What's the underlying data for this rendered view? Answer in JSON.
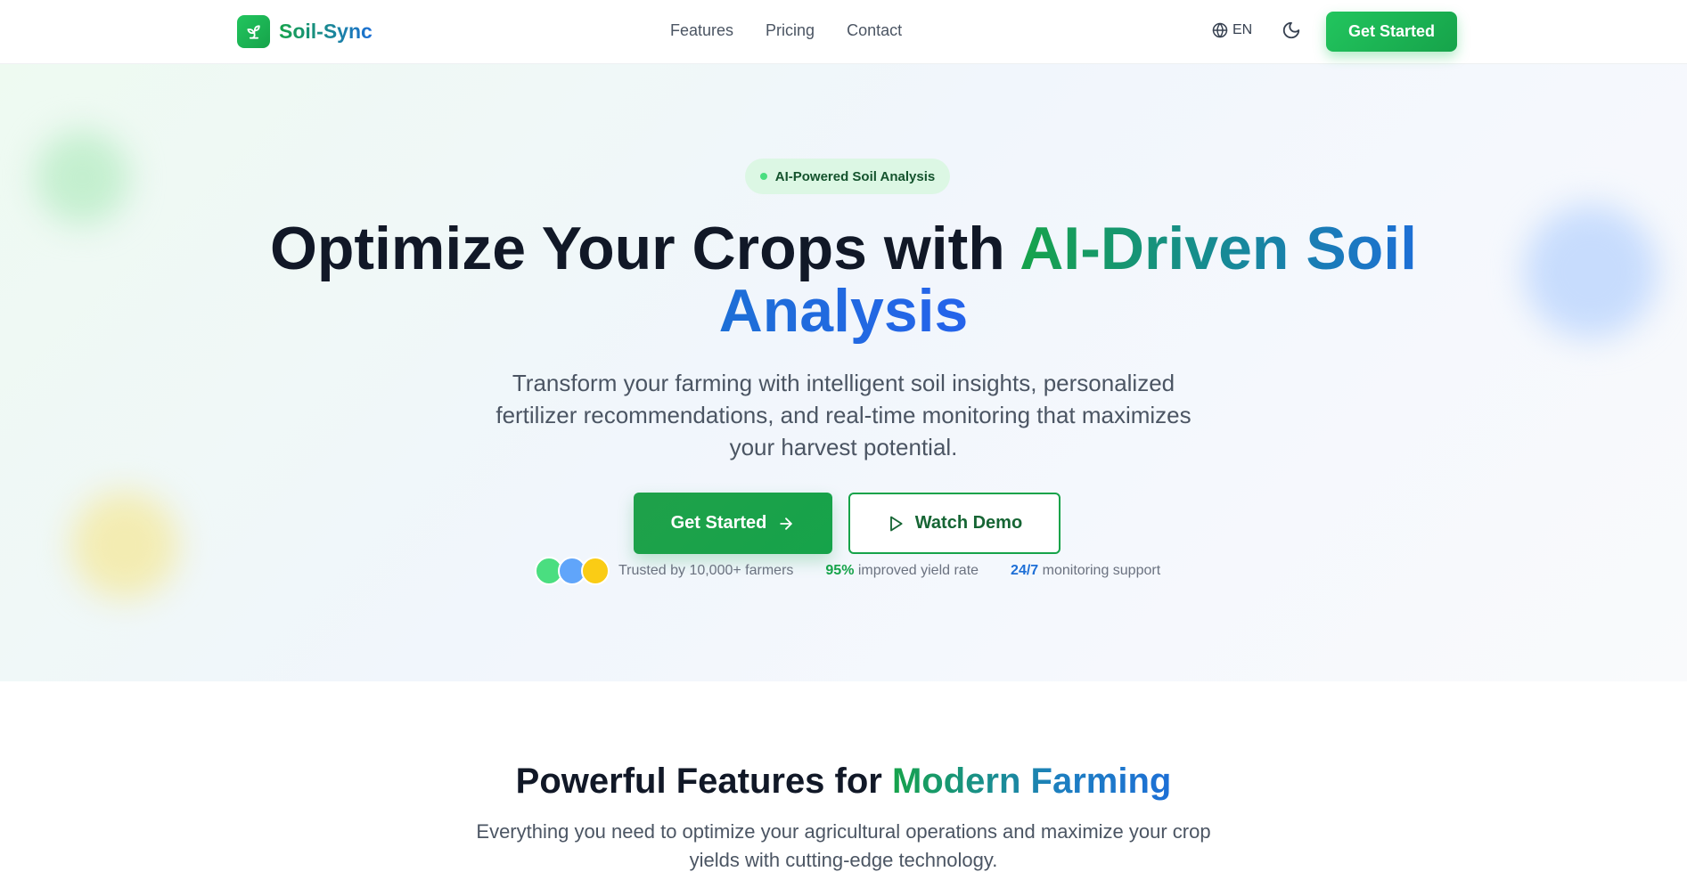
{
  "brand": {
    "name": "Soil-Sync"
  },
  "nav": {
    "items": [
      {
        "label": "Features"
      },
      {
        "label": "Pricing"
      },
      {
        "label": "Contact"
      }
    ]
  },
  "header": {
    "language": "EN",
    "cta_label": "Get Started"
  },
  "hero": {
    "badge": "AI-Powered Soil Analysis",
    "headline_plain": "Optimize Your Crops with ",
    "headline_highlight_1": "AI-Driven Soil",
    "headline_highlight_2": "Analysis",
    "subtitle": "Transform your farming with intelligent soil insights, personalized fertilizer recommendations, and real-time monitoring that maximizes your harvest potential.",
    "primary_cta": "Get Started",
    "secondary_cta": "Watch Demo",
    "trusted_text": "Trusted by 10,000+ farmers",
    "stat_yield_value": "95%",
    "stat_yield_label": " improved yield rate",
    "stat_support_value": "24/7",
    "stat_support_label": " monitoring support"
  },
  "features": {
    "title_plain": "Powerful Features for ",
    "title_highlight": "Modern Farming",
    "subtitle": "Everything you need to optimize your agricultural operations and maximize your crop yields with cutting-edge technology."
  },
  "icons": {
    "brand": "sprout-icon",
    "language": "globe-icon",
    "theme": "moon-icon",
    "arrow": "arrow-right-icon",
    "play": "play-icon"
  },
  "colors": {
    "primary_green": "#16a34a",
    "accent_blue": "#1d6fd6",
    "avatar_green": "#4ade80",
    "avatar_blue": "#60a5fa",
    "avatar_yellow": "#facc15"
  }
}
